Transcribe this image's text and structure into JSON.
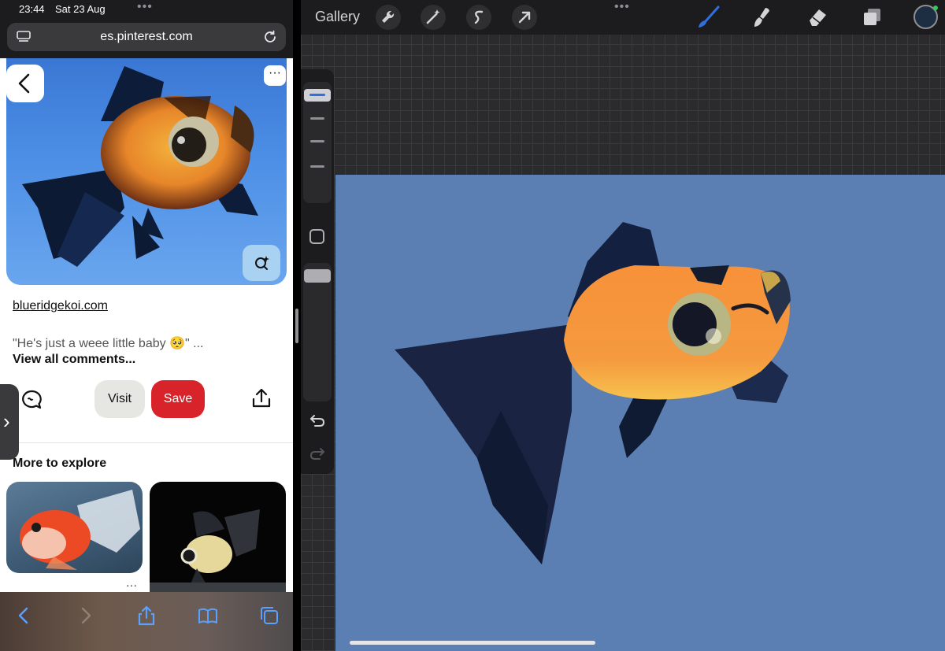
{
  "status_bar": {
    "time": "23:44",
    "date": "Sat 23 Aug",
    "dots": "•••"
  },
  "browser": {
    "url": "es.pinterest.com",
    "more_button": "···"
  },
  "pin": {
    "source_link": "blueridgekoi.com",
    "comment_preview": "\"He's just a weee little baby 🥺\" ...",
    "view_all_comments": "View all comments...",
    "visit_label": "Visit",
    "save_label": "Save",
    "more_to_explore": "More to explore",
    "tile_more": "···"
  },
  "side_handle": {
    "label": "›"
  },
  "procreate": {
    "gallery_label": "Gallery",
    "top_dots": "•••",
    "tools": [
      "wrench-icon",
      "magic-wand-icon",
      "selection-icon",
      "transform-arrow-icon"
    ],
    "right_tools": [
      "brush-icon",
      "smudge-icon",
      "eraser-icon",
      "layers-icon"
    ],
    "accent_color": "#2f6fe0",
    "canvas_color": "#5b7fb3",
    "current_color": "#1d2e43"
  }
}
